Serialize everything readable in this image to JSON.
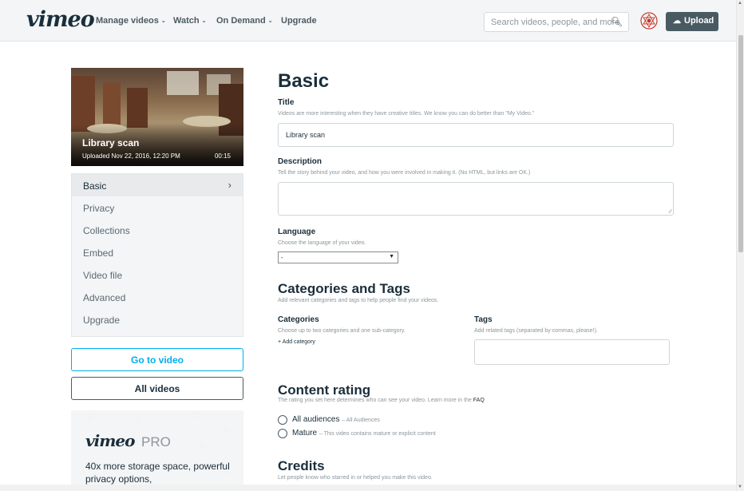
{
  "header": {
    "logo": "vimeo",
    "nav": [
      {
        "label": "Manage videos",
        "chevron": "⌄"
      },
      {
        "label": "Watch",
        "chevron": "⌄"
      },
      {
        "label": "On Demand",
        "chevron": "⌄"
      },
      {
        "label": "Upgrade",
        "chevron": ""
      }
    ],
    "search_placeholder": "Search videos, people, and more",
    "upload_label": "Upload",
    "icons": {
      "search": "magnifier-icon",
      "upload": "cloud-upload-icon",
      "avatar": "user-avatar-icon"
    }
  },
  "video": {
    "title": "Library scan",
    "uploaded": "Uploaded Nov 22, 2016, 12:20 PM",
    "duration": "00:15"
  },
  "sidebar": {
    "items": [
      {
        "label": "Basic",
        "active": true
      },
      {
        "label": "Privacy"
      },
      {
        "label": "Collections"
      },
      {
        "label": "Embed"
      },
      {
        "label": "Video file"
      },
      {
        "label": "Advanced"
      },
      {
        "label": "Upgrade"
      }
    ],
    "go_to_video": "Go to video",
    "all_videos": "All videos",
    "promo": {
      "logo": "vimeo",
      "pro": "PRO",
      "text": "40x more storage space, powerful privacy options,"
    }
  },
  "form": {
    "heading": "Basic",
    "title": {
      "label": "Title",
      "hint": "Videos are more interesting when they have creative titles. We know you can do better than \"My Video.\"",
      "value": "Library scan"
    },
    "description": {
      "label": "Description",
      "hint": "Tell the story behind your video, and how you were involved in making it. (No HTML, but links are OK.)",
      "value": ""
    },
    "language": {
      "label": "Language",
      "hint": "Choose the language of your video.",
      "selected": "-"
    },
    "categories_tags": {
      "heading": "Categories and Tags",
      "hint": "Add relevant categories and tags to help people find your videos.",
      "categories_label": "Categories",
      "categories_hint": "Choose up to two categories and one sub-category.",
      "add_category": "+ Add category",
      "tags_label": "Tags",
      "tags_hint": "Add related tags (separated by commas, please!).",
      "tags_value": ""
    },
    "content_rating": {
      "heading": "Content rating",
      "hint": "The rating you set here determines who can see your video. Learn more in the",
      "faq_link": "FAQ",
      "options": [
        {
          "label": "All audiences",
          "sub": "– All Audiences",
          "selected": false
        },
        {
          "label": "Mature",
          "sub": "– This video contains mature or explicit content",
          "selected": false
        }
      ]
    },
    "credits": {
      "heading": "Credits",
      "hint": "Let people know who starred in or helped you make this video."
    }
  },
  "colors": {
    "accent": "#00adef",
    "text_dark": "#1a2e3b",
    "muted": "#8c969c",
    "upload_bg": "#4a5a63"
  }
}
